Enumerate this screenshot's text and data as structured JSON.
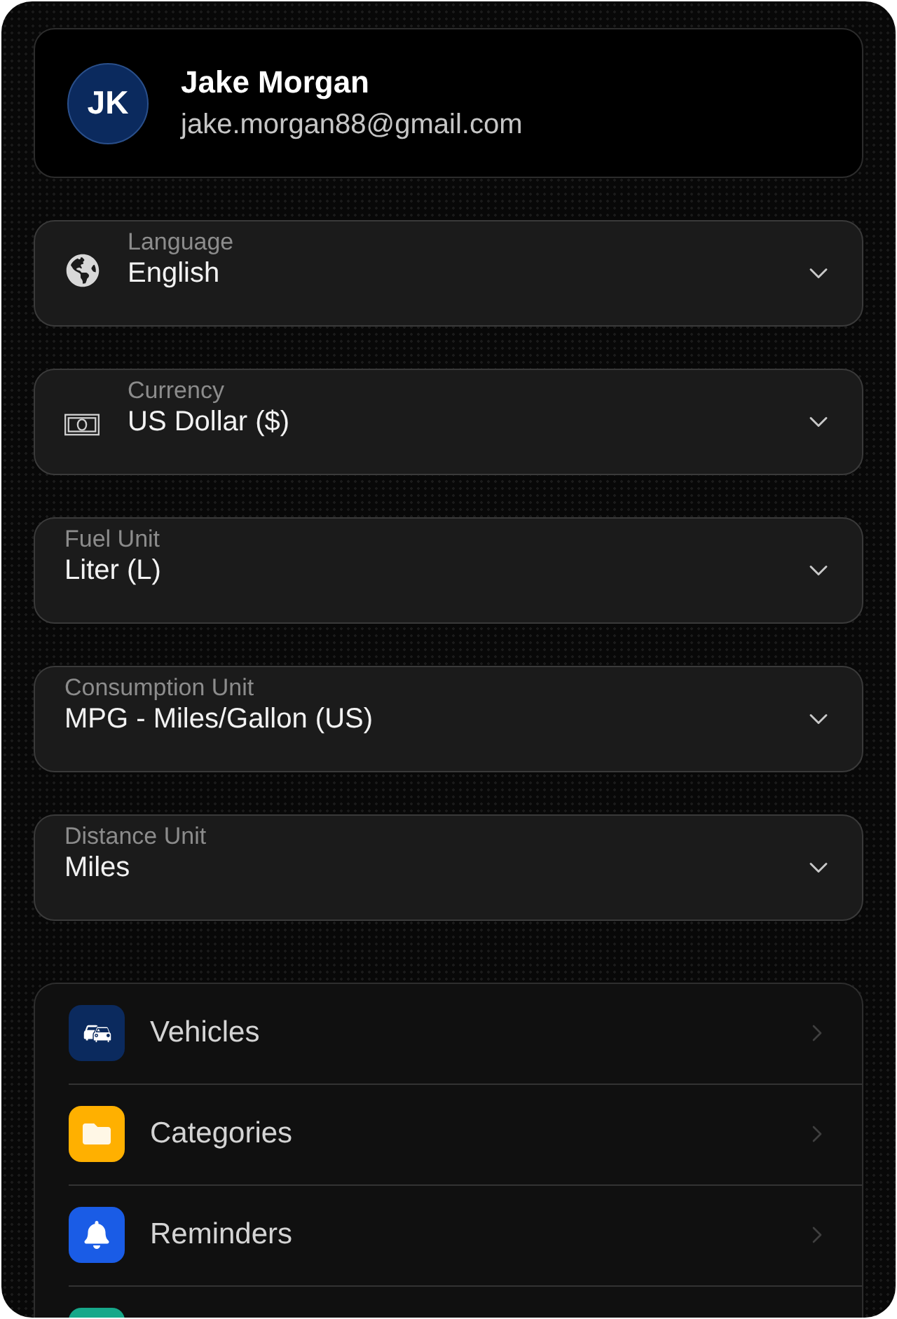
{
  "profile": {
    "initials": "JK",
    "name": "Jake Morgan",
    "email": "jake.morgan88@gmail.com"
  },
  "settings": [
    {
      "kind": "icon",
      "label": "Language",
      "value": "English"
    },
    {
      "kind": "icon",
      "label": "Currency",
      "value": "US Dollar ($)"
    },
    {
      "kind": "plain",
      "label": "Fuel Unit",
      "value": "Liter (L)"
    },
    {
      "kind": "plain",
      "label": "Consumption Unit",
      "value": "MPG - Miles/Gallon (US)"
    },
    {
      "kind": "plain",
      "label": "Distance Unit",
      "value": "Miles"
    }
  ],
  "menu": {
    "items": [
      {
        "label": "Vehicles",
        "color": "#0b2a5e"
      },
      {
        "label": "Categories",
        "color": "#ffb000"
      },
      {
        "label": "Reminders",
        "color": "#1a5ce6"
      },
      {
        "color": "#17a88a"
      }
    ]
  }
}
